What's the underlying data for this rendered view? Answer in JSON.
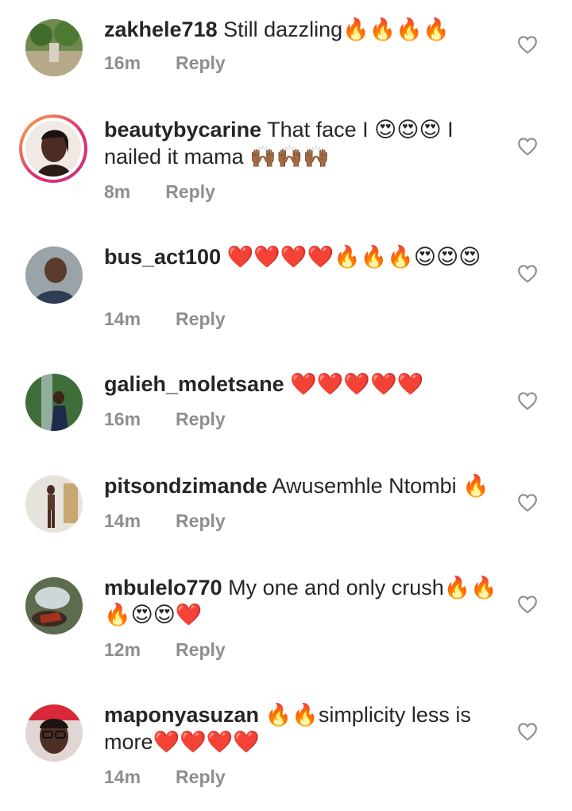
{
  "comments": [
    {
      "username": "zakhele718",
      "text": "Still dazzling🔥🔥🔥🔥",
      "time": "16m",
      "reply": "Reply",
      "like_icon": "heart-outline-icon"
    },
    {
      "username": "beautybycarine",
      "text": "That face I 😍😍😍 I nailed it mama 🙌🏾🙌🏾🙌🏾",
      "time": "8m",
      "reply": "Reply",
      "like_icon": "heart-outline-icon"
    },
    {
      "username": "bus_act100",
      "text": "❤️❤️❤️❤️🔥🔥🔥😍😍😍",
      "time": "14m",
      "reply": "Reply",
      "like_icon": "heart-outline-icon"
    },
    {
      "username": "galieh_moletsane",
      "text": "❤️❤️❤️❤️❤️",
      "time": "16m",
      "reply": "Reply",
      "like_icon": "heart-outline-icon"
    },
    {
      "username": "pitsondzimande",
      "text": "Awusemhle Ntombi 🔥",
      "time": "14m",
      "reply": "Reply",
      "like_icon": "heart-outline-icon"
    },
    {
      "username": "mbulelo770",
      "text": "My one and only crush🔥🔥🔥😍😍❤️",
      "time": "12m",
      "reply": "Reply",
      "like_icon": "heart-outline-icon"
    },
    {
      "username": "maponyasuzan",
      "text": "🔥🔥simplicity less is more❤️❤️❤️❤️",
      "time": "14m",
      "reply": "Reply",
      "like_icon": "heart-outline-icon"
    }
  ]
}
